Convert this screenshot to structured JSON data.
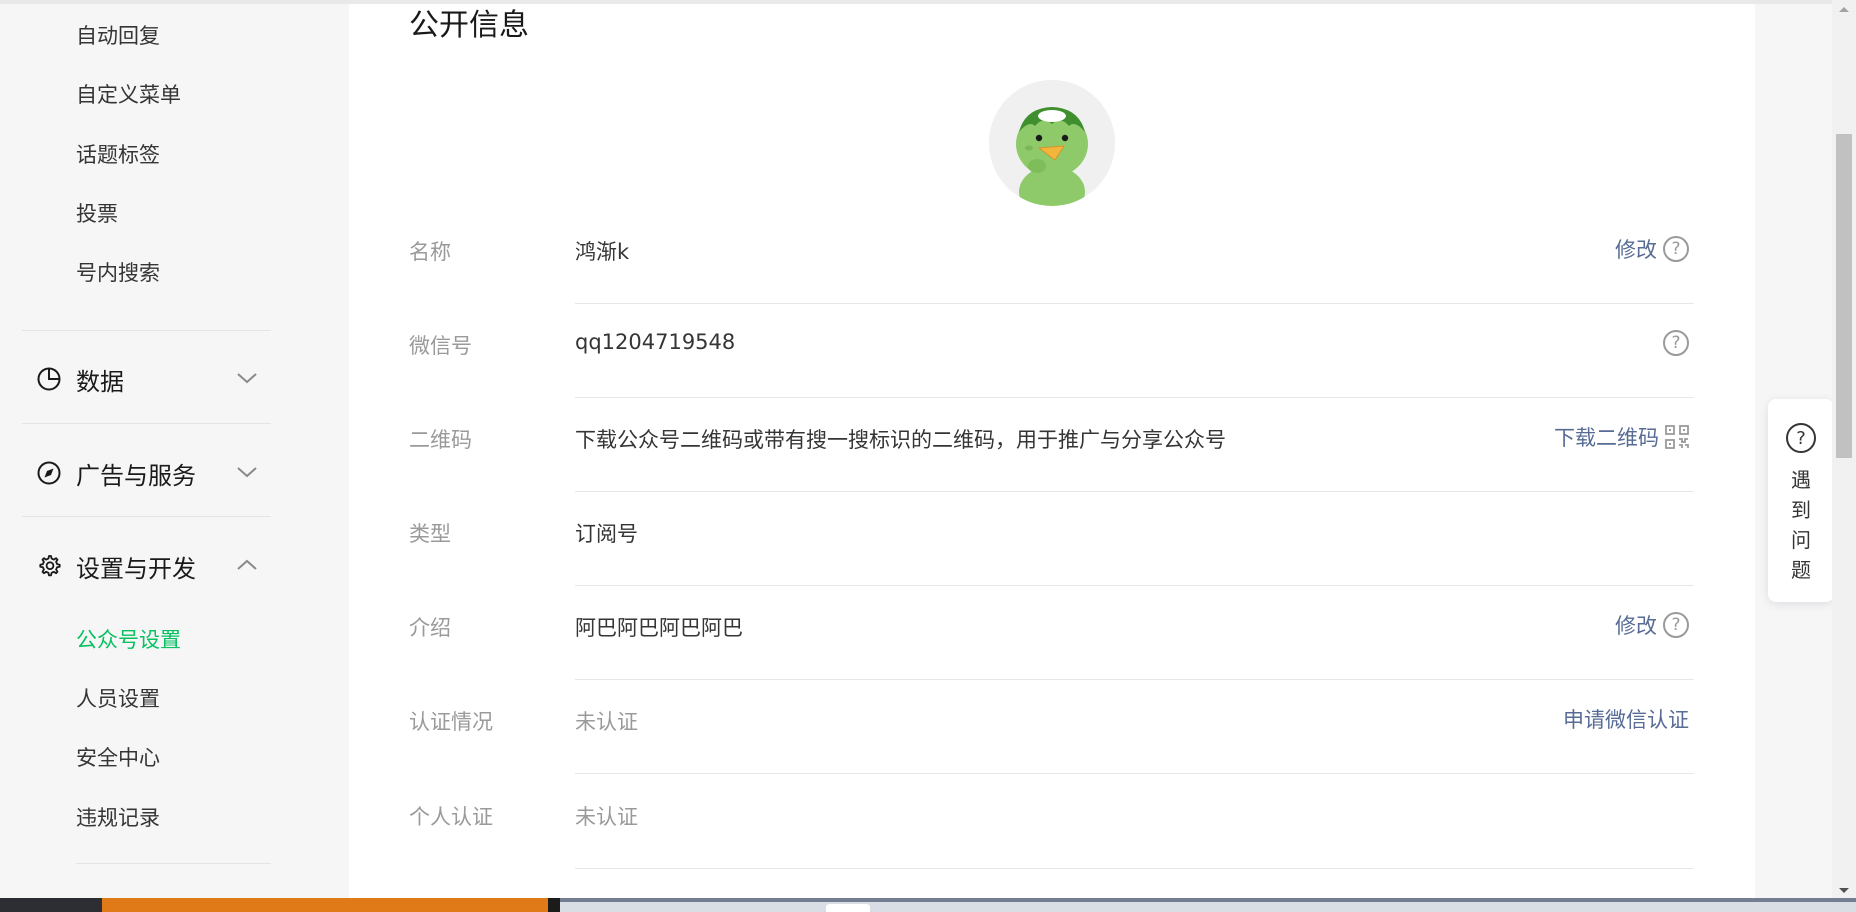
{
  "sidebar": {
    "top_items": [
      "自动回复",
      "自定义菜单",
      "话题标签",
      "投票",
      "号内搜索"
    ],
    "groups": [
      {
        "label": "数据",
        "icon": "pie-chart-icon",
        "expanded": false
      },
      {
        "label": "广告与服务",
        "icon": "compass-icon",
        "expanded": false
      },
      {
        "label": "设置与开发",
        "icon": "gear-icon",
        "expanded": true
      }
    ],
    "settings_items": [
      {
        "label": "公众号设置",
        "active": true
      },
      {
        "label": "人员设置",
        "active": false
      },
      {
        "label": "安全中心",
        "active": false
      },
      {
        "label": "违规记录",
        "active": false
      }
    ]
  },
  "main": {
    "title": "公开信息",
    "rows": [
      {
        "label": "名称",
        "value": "鸿渐k",
        "action": "修改"
      },
      {
        "label": "微信号",
        "value": "qq1204719548"
      },
      {
        "label": "二维码",
        "value": "下载公众号二维码或带有搜一搜标识的二维码，用于推广与分享公众号",
        "action": "下载二维码"
      },
      {
        "label": "类型",
        "value": "订阅号"
      },
      {
        "label": "介绍",
        "value": "阿巴阿巴阿巴阿巴",
        "action": "修改"
      },
      {
        "label": "认证情况",
        "value": "未认证",
        "action": "申请微信认证"
      },
      {
        "label": "个人认证",
        "value": "未认证"
      }
    ]
  },
  "help_widget": {
    "icon": "?",
    "label": "遇到问题"
  },
  "colors": {
    "accent_green": "#07c160",
    "link_blue": "#576b95",
    "sidebar_bg": "#f6f6f7",
    "card_bg": "#ffffff"
  }
}
